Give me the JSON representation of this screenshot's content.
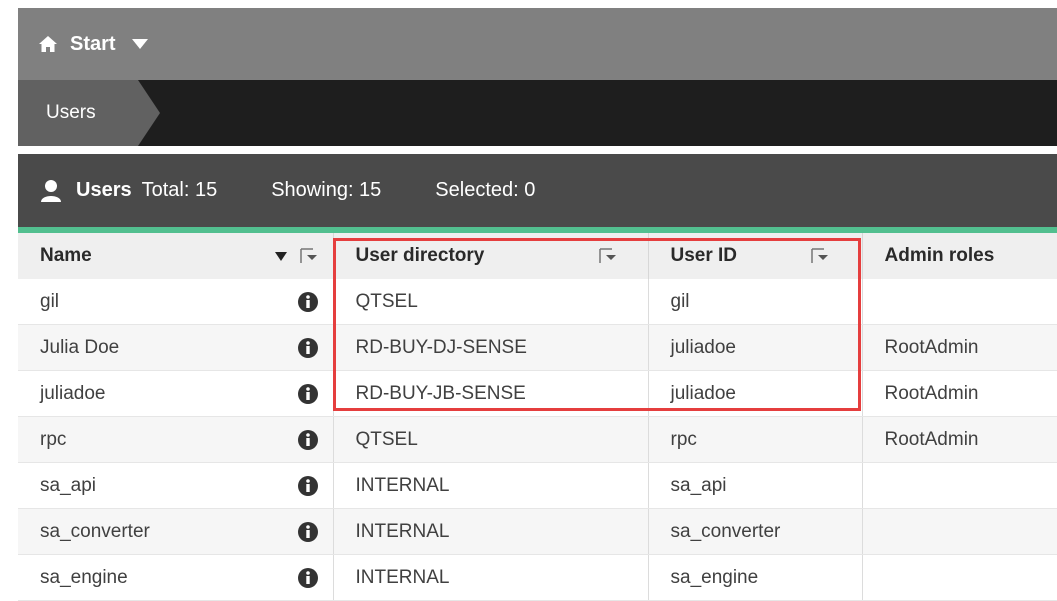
{
  "topbar": {
    "start_label": "Start"
  },
  "breadcrumb": {
    "current": "Users"
  },
  "panel": {
    "title": "Users",
    "total": "Total: 15",
    "showing": "Showing: 15",
    "selected": "Selected: 0"
  },
  "table": {
    "headers": {
      "name": "Name",
      "user_directory": "User directory",
      "user_id": "User ID",
      "admin_roles": "Admin roles"
    },
    "rows": [
      {
        "name": "gil",
        "user_directory": "QTSEL",
        "user_id": "gil",
        "admin_roles": ""
      },
      {
        "name": "Julia Doe",
        "user_directory": "RD-BUY-DJ-SENSE",
        "user_id": "juliadoe",
        "admin_roles": "RootAdmin"
      },
      {
        "name": "juliadoe",
        "user_directory": "RD-BUY-JB-SENSE",
        "user_id": "juliadoe",
        "admin_roles": "RootAdmin"
      },
      {
        "name": "rpc",
        "user_directory": "QTSEL",
        "user_id": "rpc",
        "admin_roles": "RootAdmin"
      },
      {
        "name": "sa_api",
        "user_directory": "INTERNAL",
        "user_id": "sa_api",
        "admin_roles": ""
      },
      {
        "name": "sa_converter",
        "user_directory": "INTERNAL",
        "user_id": "sa_converter",
        "admin_roles": ""
      },
      {
        "name": "sa_engine",
        "user_directory": "INTERNAL",
        "user_id": "sa_engine",
        "admin_roles": ""
      }
    ]
  },
  "colors": {
    "accent_green": "#52bf8f",
    "highlight_red": "#e53e3e"
  }
}
